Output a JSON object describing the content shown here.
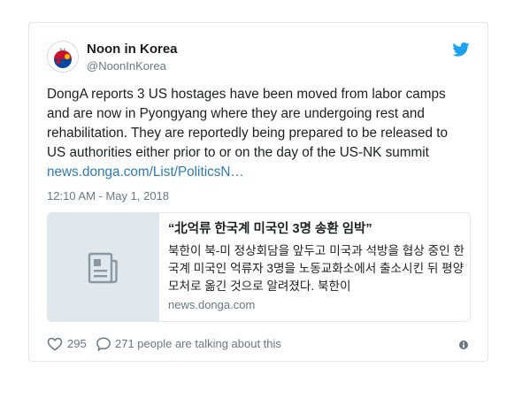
{
  "author": {
    "name": "Noon in Korea",
    "handle": "@NoonInKorea",
    "avatar_icon": "noon-in-korea-logo-icon"
  },
  "tweet": {
    "lines": [
      "DongA reports 3 US hostages have been moved from labor camps",
      "and are now in Pyongyang where they are undergoing rest and",
      "rehabilitation. They are reportedly being prepared to be released to",
      "US authorities either prior to or on the day of the US-NK summit"
    ],
    "link_text": "news.donga.com/List/PoliticsN…",
    "timestamp": "12:10 AM - May 1, 2018"
  },
  "link_card": {
    "title": "“北억류 한국계 미국인 3명 송환 임박”",
    "description": "북한이 북-미 정상회담을 앞두고 미국과 석방을 협상 중인 한국계 미국인 억류자 3명을 노동교화소에서 출소시킨 뒤 평양 모처로 옮긴 것으로 알려졌다. 북한이",
    "domain": "news.donga.com",
    "thumb_icon": "document-icon"
  },
  "footer": {
    "like_count": "295",
    "talk_text": "271 people are talking about this",
    "like_icon": "heart-icon",
    "reply_icon": "speech-bubble-icon",
    "info_icon": "info-icon"
  },
  "colors": {
    "link": "#2b7bb9",
    "muted": "#697882",
    "text": "#1c2022",
    "border": "#e1e8ed",
    "twitter_blue": "#1da1f2"
  }
}
